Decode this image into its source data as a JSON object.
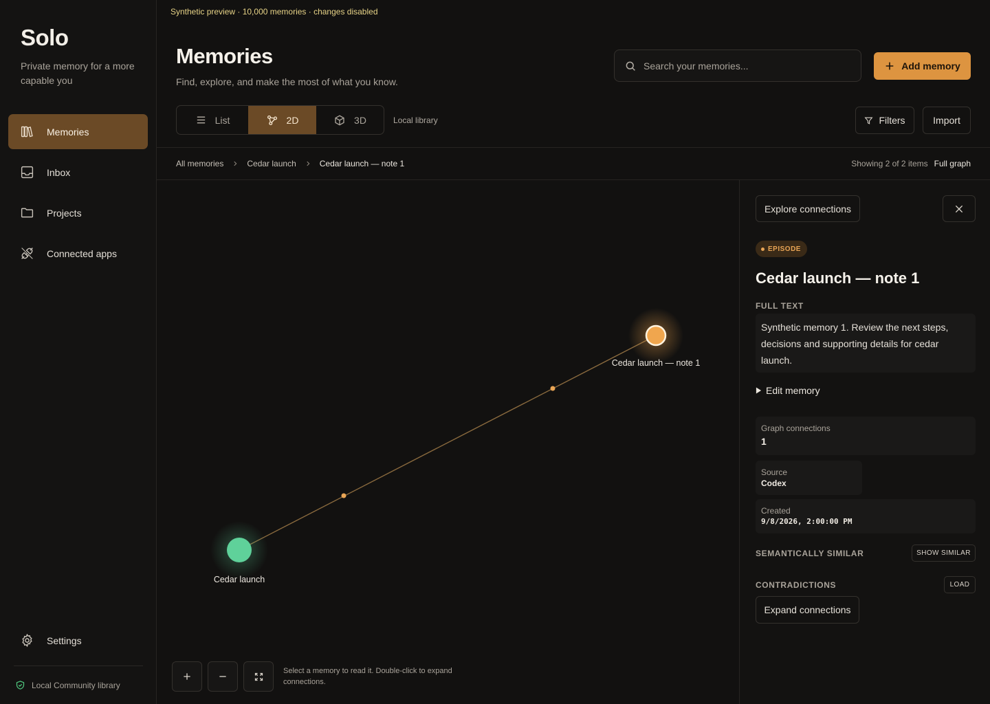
{
  "app": {
    "name": "Solo",
    "tagline": "Private memory for a more capable you",
    "banner": "Synthetic preview · 10,000 memories · changes disabled"
  },
  "sidebar": {
    "items": [
      {
        "label": "Memories",
        "icon": "books-icon",
        "active": true
      },
      {
        "label": "Inbox",
        "icon": "inbox-icon"
      },
      {
        "label": "Projects",
        "icon": "folder-icon"
      },
      {
        "label": "Connected apps",
        "icon": "plug-icon"
      }
    ],
    "settings_label": "Settings",
    "library_label": "Local Community library"
  },
  "header": {
    "title": "Memories",
    "subtitle": "Find, explore, and make the most of what you know.",
    "search_placeholder": "Search your memories...",
    "add_label": "Add memory"
  },
  "view": {
    "modes": [
      {
        "label": "List",
        "icon": "list-icon"
      },
      {
        "label": "2D",
        "icon": "graph-icon",
        "active": true
      },
      {
        "label": "3D",
        "icon": "cube-icon"
      }
    ],
    "library_label": "Local library",
    "filters_label": "Filters",
    "import_label": "Import"
  },
  "breadcrumb": {
    "items": [
      "All memories",
      "Cedar launch",
      "Cedar launch — note 1"
    ],
    "showing": "Showing 2 of 2 items",
    "full_graph": "Full graph"
  },
  "graph": {
    "nodes": [
      {
        "label": "Cedar launch",
        "color": "#5fd19a"
      },
      {
        "label": "Cedar launch — note 1",
        "color": "#f0a64e",
        "selected": true
      }
    ],
    "edge_color": "#8a6a3e",
    "hint": "Select a memory to read it. Double-click to expand connections."
  },
  "detail": {
    "explore_label": "Explore connections",
    "badge": "EPISODE",
    "title": "Cedar launch — note 1",
    "full_text_label": "FULL TEXT",
    "full_text": "Synthetic memory 1. Review the next steps, decisions and supporting details for cedar launch.",
    "edit_label": "Edit memory",
    "connections_label": "Graph connections",
    "connections_value": "1",
    "source_label": "Source",
    "source_value": "Codex",
    "created_label": "Created",
    "created_value": "9/8/2026, 2:00:00 PM",
    "similar_label": "SEMANTICALLY SIMILAR",
    "similar_button": "SHOW SIMILAR",
    "contradictions_label": "CONTRADICTIONS",
    "load_button": "LOAD",
    "expand_label": "Expand connections"
  },
  "colors": {
    "accent": "#dd9440",
    "active_bg": "#6b4a26",
    "background": "#121110"
  }
}
